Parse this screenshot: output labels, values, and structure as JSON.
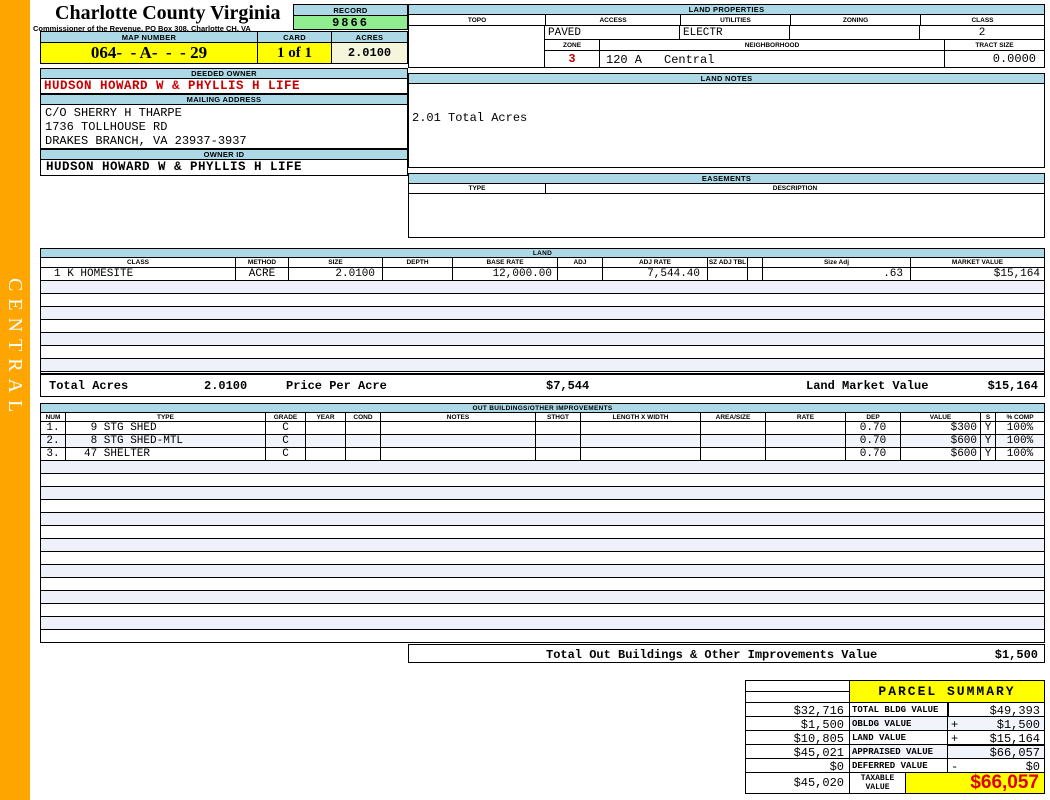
{
  "colors": {
    "sidebar_orange": "#FFA500",
    "header_blue": "#ADD8E6",
    "highlight_yellow": "#FFFF00",
    "record_green": "#90EE90",
    "acres_cream": "#F5F5DC",
    "alert_red": "#CC0000",
    "stripe_blue": "#EEF1F9"
  },
  "sidebar": {
    "district": "CENTRAL"
  },
  "header": {
    "county": "Charlotte County Virginia",
    "subtitle": "Commissioner of the Revenue, PO Box 308, Charlotte CH, VA",
    "record_label": "RECORD",
    "record_value": "9866",
    "map_number_label": "MAP NUMBER",
    "map_number_value": "064-  - A-  -  - 29",
    "card_label": "CARD",
    "card_value": "1 of 1",
    "acres_label": "ACRES",
    "acres_value": "2.0100"
  },
  "owner": {
    "deeded_owner_label": "DEEDED OWNER",
    "deeded_owner": "HUDSON HOWARD W & PHYLLIS H LIFE",
    "mailing_address_label": "MAILING ADDRESS",
    "address_line1": "C/O SHERRY H THARPE",
    "address_line2": "1736 TOLLHOUSE RD",
    "address_line3": "DRAKES BRANCH, VA 23937-3937",
    "owner_id_label": "OWNER ID",
    "owner_id": "HUDSON HOWARD W & PHYLLIS H LIFE"
  },
  "land_properties": {
    "title": "LAND PROPERTIES",
    "topo_label": "TOPO",
    "access_label": "ACCESS",
    "utilities_label": "UTILITIES",
    "zoning_label": "ZONING",
    "class_label": "CLASS",
    "topo": "",
    "access": "PAVED",
    "utilities": "ELECTR",
    "zoning": "",
    "class": "2",
    "zone_label": "ZONE",
    "zone": "3",
    "neighborhood_label": "NEIGHBORHOOD",
    "neighborhood_code": "120 A",
    "neighborhood_name": "Central",
    "tract_size_label": "TRACT SIZE",
    "tract_size": "0.0000"
  },
  "land_notes": {
    "title": "LAND NOTES",
    "note": "2.01 Total Acres"
  },
  "easements": {
    "title": "EASEMENTS",
    "type_label": "TYPE",
    "description_label": "DESCRIPTION"
  },
  "land": {
    "title": "LAND",
    "columns": [
      "CLASS",
      "METHOD",
      "SIZE",
      "DEPTH",
      "BASE RATE",
      "ADJ",
      "ADJ RATE",
      "SZ ADJ TBL",
      "",
      "Size Adj",
      "MARKET VALUE"
    ],
    "rows": [
      {
        "class": "1 K HOMESITE",
        "method": "ACRE",
        "size": "2.0100",
        "depth": "",
        "base_rate": "12,000.00",
        "adj": "",
        "adj_rate": "7,544.40",
        "sz_adj_tbl": "",
        "size_adj": ".63",
        "market_value": "$15,164"
      }
    ],
    "total_acres_label": "Total Acres",
    "total_acres": "2.0100",
    "price_per_acre_label": "Price Per Acre",
    "price_per_acre": "$7,544",
    "land_market_value_label": "Land Market Value",
    "land_market_value": "$15,164"
  },
  "out_buildings": {
    "title": "OUT BUILDINGS/OTHER IMPROVEMENTS",
    "columns": [
      "NUM",
      "TYPE",
      "GRADE",
      "YEAR",
      "COND",
      "NOTES",
      "STHGT",
      "LENGTH X WIDTH",
      "AREA/SIZE",
      "RATE",
      "DEP",
      "VALUE",
      "S",
      "% COMP"
    ],
    "rows": [
      {
        "num": "1.",
        "type": " 9 STG SHED",
        "grade": "C",
        "dep": "0.70",
        "value": "$300",
        "s": "Y",
        "pct_comp": "100%"
      },
      {
        "num": "2.",
        "type": " 8 STG SHED-MTL",
        "grade": "C",
        "dep": "0.70",
        "value": "$600",
        "s": "Y",
        "pct_comp": "100%"
      },
      {
        "num": "3.",
        "type": "47 SHELTER",
        "grade": "C",
        "dep": "0.70",
        "value": "$600",
        "s": "Y",
        "pct_comp": "100%"
      }
    ],
    "total_label": "Total Out Buildings & Other Improvements Value",
    "total_value": "$1,500"
  },
  "parcel_summary": {
    "title": "PARCEL SUMMARY",
    "rows": [
      {
        "prev": "$32,716",
        "label": "TOTAL BLDG VALUE",
        "op": "",
        "value": "$49,393"
      },
      {
        "prev": "$1,500",
        "label": "OBLDG VALUE",
        "op": "+",
        "value": "$1,500"
      },
      {
        "prev": "$10,805",
        "label": "LAND VALUE",
        "op": "+",
        "value": "$15,164"
      },
      {
        "prev": "$45,021",
        "label": "APPRAISED VALUE",
        "op": "",
        "value": "$66,057"
      },
      {
        "prev": "$0",
        "label": "DEFERRED VALUE",
        "op": "-",
        "value": "$0"
      }
    ],
    "taxable": {
      "prev": "$45,020",
      "label": "TAXABLE VALUE",
      "value": "$66,057"
    }
  }
}
